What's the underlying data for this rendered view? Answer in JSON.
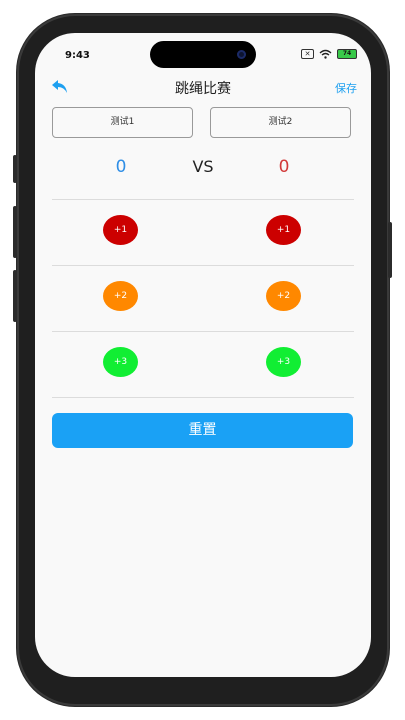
{
  "status_bar": {
    "time": "9:43",
    "sim_label": "✕",
    "battery": "74"
  },
  "nav": {
    "title": "跳绳比赛",
    "save_label": "保存"
  },
  "players": {
    "left_name": "测试1",
    "right_name": "测试2"
  },
  "scores": {
    "left": "0",
    "right": "0",
    "vs_label": "VS"
  },
  "buttons": {
    "plus1": "+1",
    "plus2": "+2",
    "plus3": "+3",
    "reset_label": "重置"
  },
  "colors": {
    "accent": "#1ea0f0",
    "left_score": "#2f8ee6",
    "right_score": "#d23a3a",
    "plus1": "#cc0000",
    "plus2": "#ff8800",
    "plus3": "#11ee33",
    "reset_bg": "#1aa1f5"
  }
}
